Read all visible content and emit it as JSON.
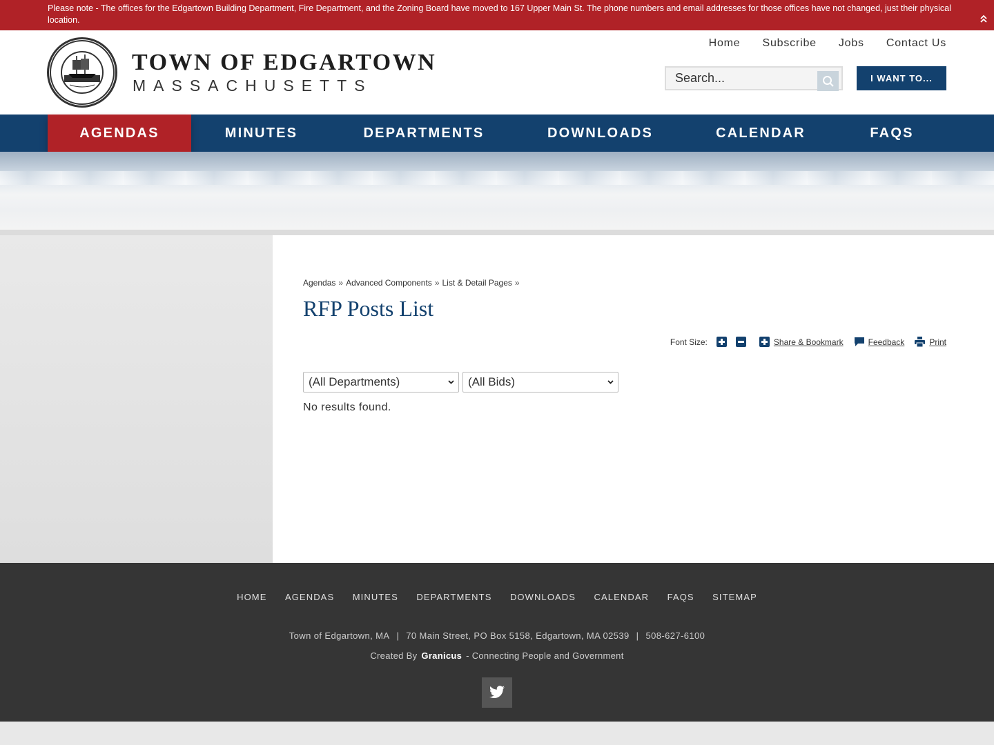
{
  "alert": {
    "text": "Please note - The offices for the Edgartown Building Department, Fire Department, and the Zoning Board have moved to 167 Upper Main St. The phone numbers and email addresses for those offices have not changed, just their physical location.",
    "toggle_icon": "chevron-double-up-icon",
    "background": "#b02227"
  },
  "header": {
    "seal_text_top": "MARTHA'S VINEYARD",
    "seal_text_left": "EDGARTOWN",
    "seal_text_right": "MASS",
    "seal_text_bottom": "INCORPORATED 1671",
    "title": "TOWN OF EDGARTOWN",
    "subtitle": "MASSACHUSETTS",
    "util_nav": [
      "Home",
      "Subscribe",
      "Jobs",
      "Contact Us"
    ],
    "search_placeholder": "Search...",
    "i_want_to": "I WANT TO..."
  },
  "main_nav": {
    "items": [
      "AGENDAS",
      "MINUTES",
      "DEPARTMENTS",
      "DOWNLOADS",
      "CALENDAR",
      "FAQS"
    ],
    "active": "AGENDAS",
    "color": "#13416e",
    "active_color": "#b02227"
  },
  "content": {
    "breadcrumb": [
      "Agendas",
      "Advanced Components",
      "List & Detail Pages"
    ],
    "breadcrumb_sep": "»",
    "title": "RFP Posts List",
    "tools": {
      "font_size_label": "Font Size:",
      "share": "Share & Bookmark",
      "feedback": "Feedback",
      "print": "Print"
    },
    "filters": {
      "department": "(All Departments)",
      "bids": "(All Bids)"
    },
    "empty_message": "No results found."
  },
  "footer": {
    "nav": [
      "HOME",
      "AGENDAS",
      "MINUTES",
      "DEPARTMENTS",
      "DOWNLOADS",
      "CALENDAR",
      "FAQS",
      "SITEMAP"
    ],
    "address": {
      "name": "Town of Edgartown, MA",
      "street": "70 Main Street, PO Box 5158, Edgartown, MA 02539",
      "phone": "508-627-6100"
    },
    "credit_prefix": "Created By",
    "credit_brand": "Granicus",
    "credit_suffix": "- Connecting People and Government",
    "social_icon": "twitter-icon"
  }
}
